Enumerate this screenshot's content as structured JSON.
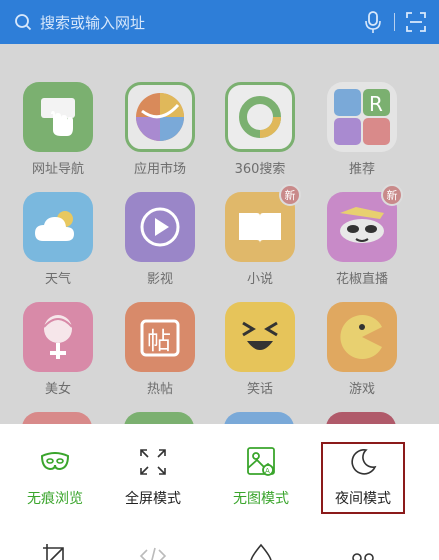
{
  "search": {
    "placeholder": "搜索或输入网址"
  },
  "apps": [
    {
      "label": "网址导航"
    },
    {
      "label": "应用市场"
    },
    {
      "label": "360搜索"
    },
    {
      "label": "推荐"
    },
    {
      "label": "天气"
    },
    {
      "label": "影视"
    },
    {
      "label": "小说",
      "badge": "新"
    },
    {
      "label": "花椒直播",
      "badge": "新"
    },
    {
      "label": "美女"
    },
    {
      "label": "热帖"
    },
    {
      "label": "笑话"
    },
    {
      "label": "游戏"
    }
  ],
  "menu": {
    "row1": [
      {
        "label": "无痕浏览"
      },
      {
        "label": "全屏模式"
      },
      {
        "label": "无图模式"
      },
      {
        "label": "夜间模式"
      }
    ]
  },
  "colors": {
    "accent_blue": "#2e7ed8",
    "menu_green": "#3aa52c",
    "highlight": "#8b1a1a"
  }
}
